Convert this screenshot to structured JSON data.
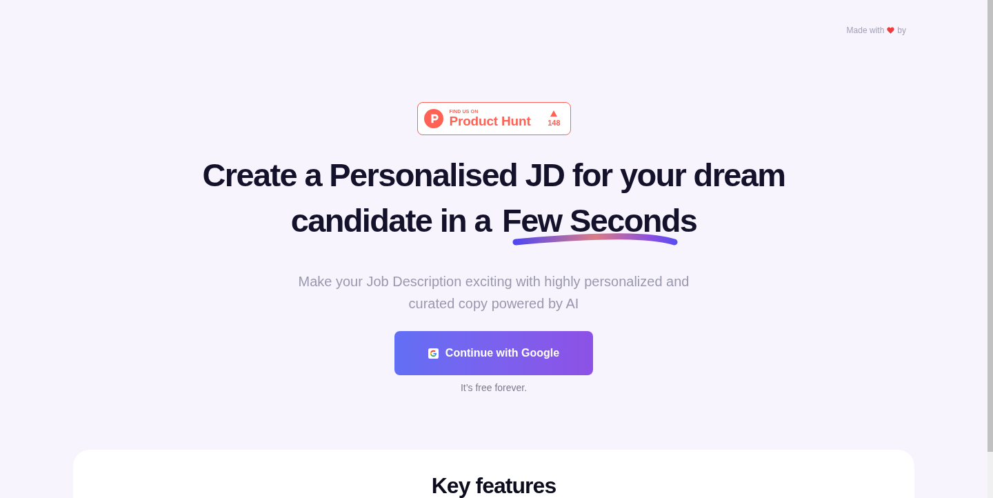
{
  "top_note": {
    "text_before": "Made with",
    "text_after": "by"
  },
  "product_hunt_badge": {
    "kicker": "FIND US ON",
    "name": "Product Hunt",
    "upvotes": "148"
  },
  "hero": {
    "headline_lines": [
      "Create a Personalised JD for your dream",
      "candidate in a"
    ],
    "highlight": "Few Seconds",
    "subtitle": "Make your Job Description exciting with highly personalized and curated copy powered by AI",
    "cta": {
      "label": "Continue with Google"
    },
    "cta_note": "It’s free forever."
  },
  "features": {
    "title": "Key features"
  }
}
